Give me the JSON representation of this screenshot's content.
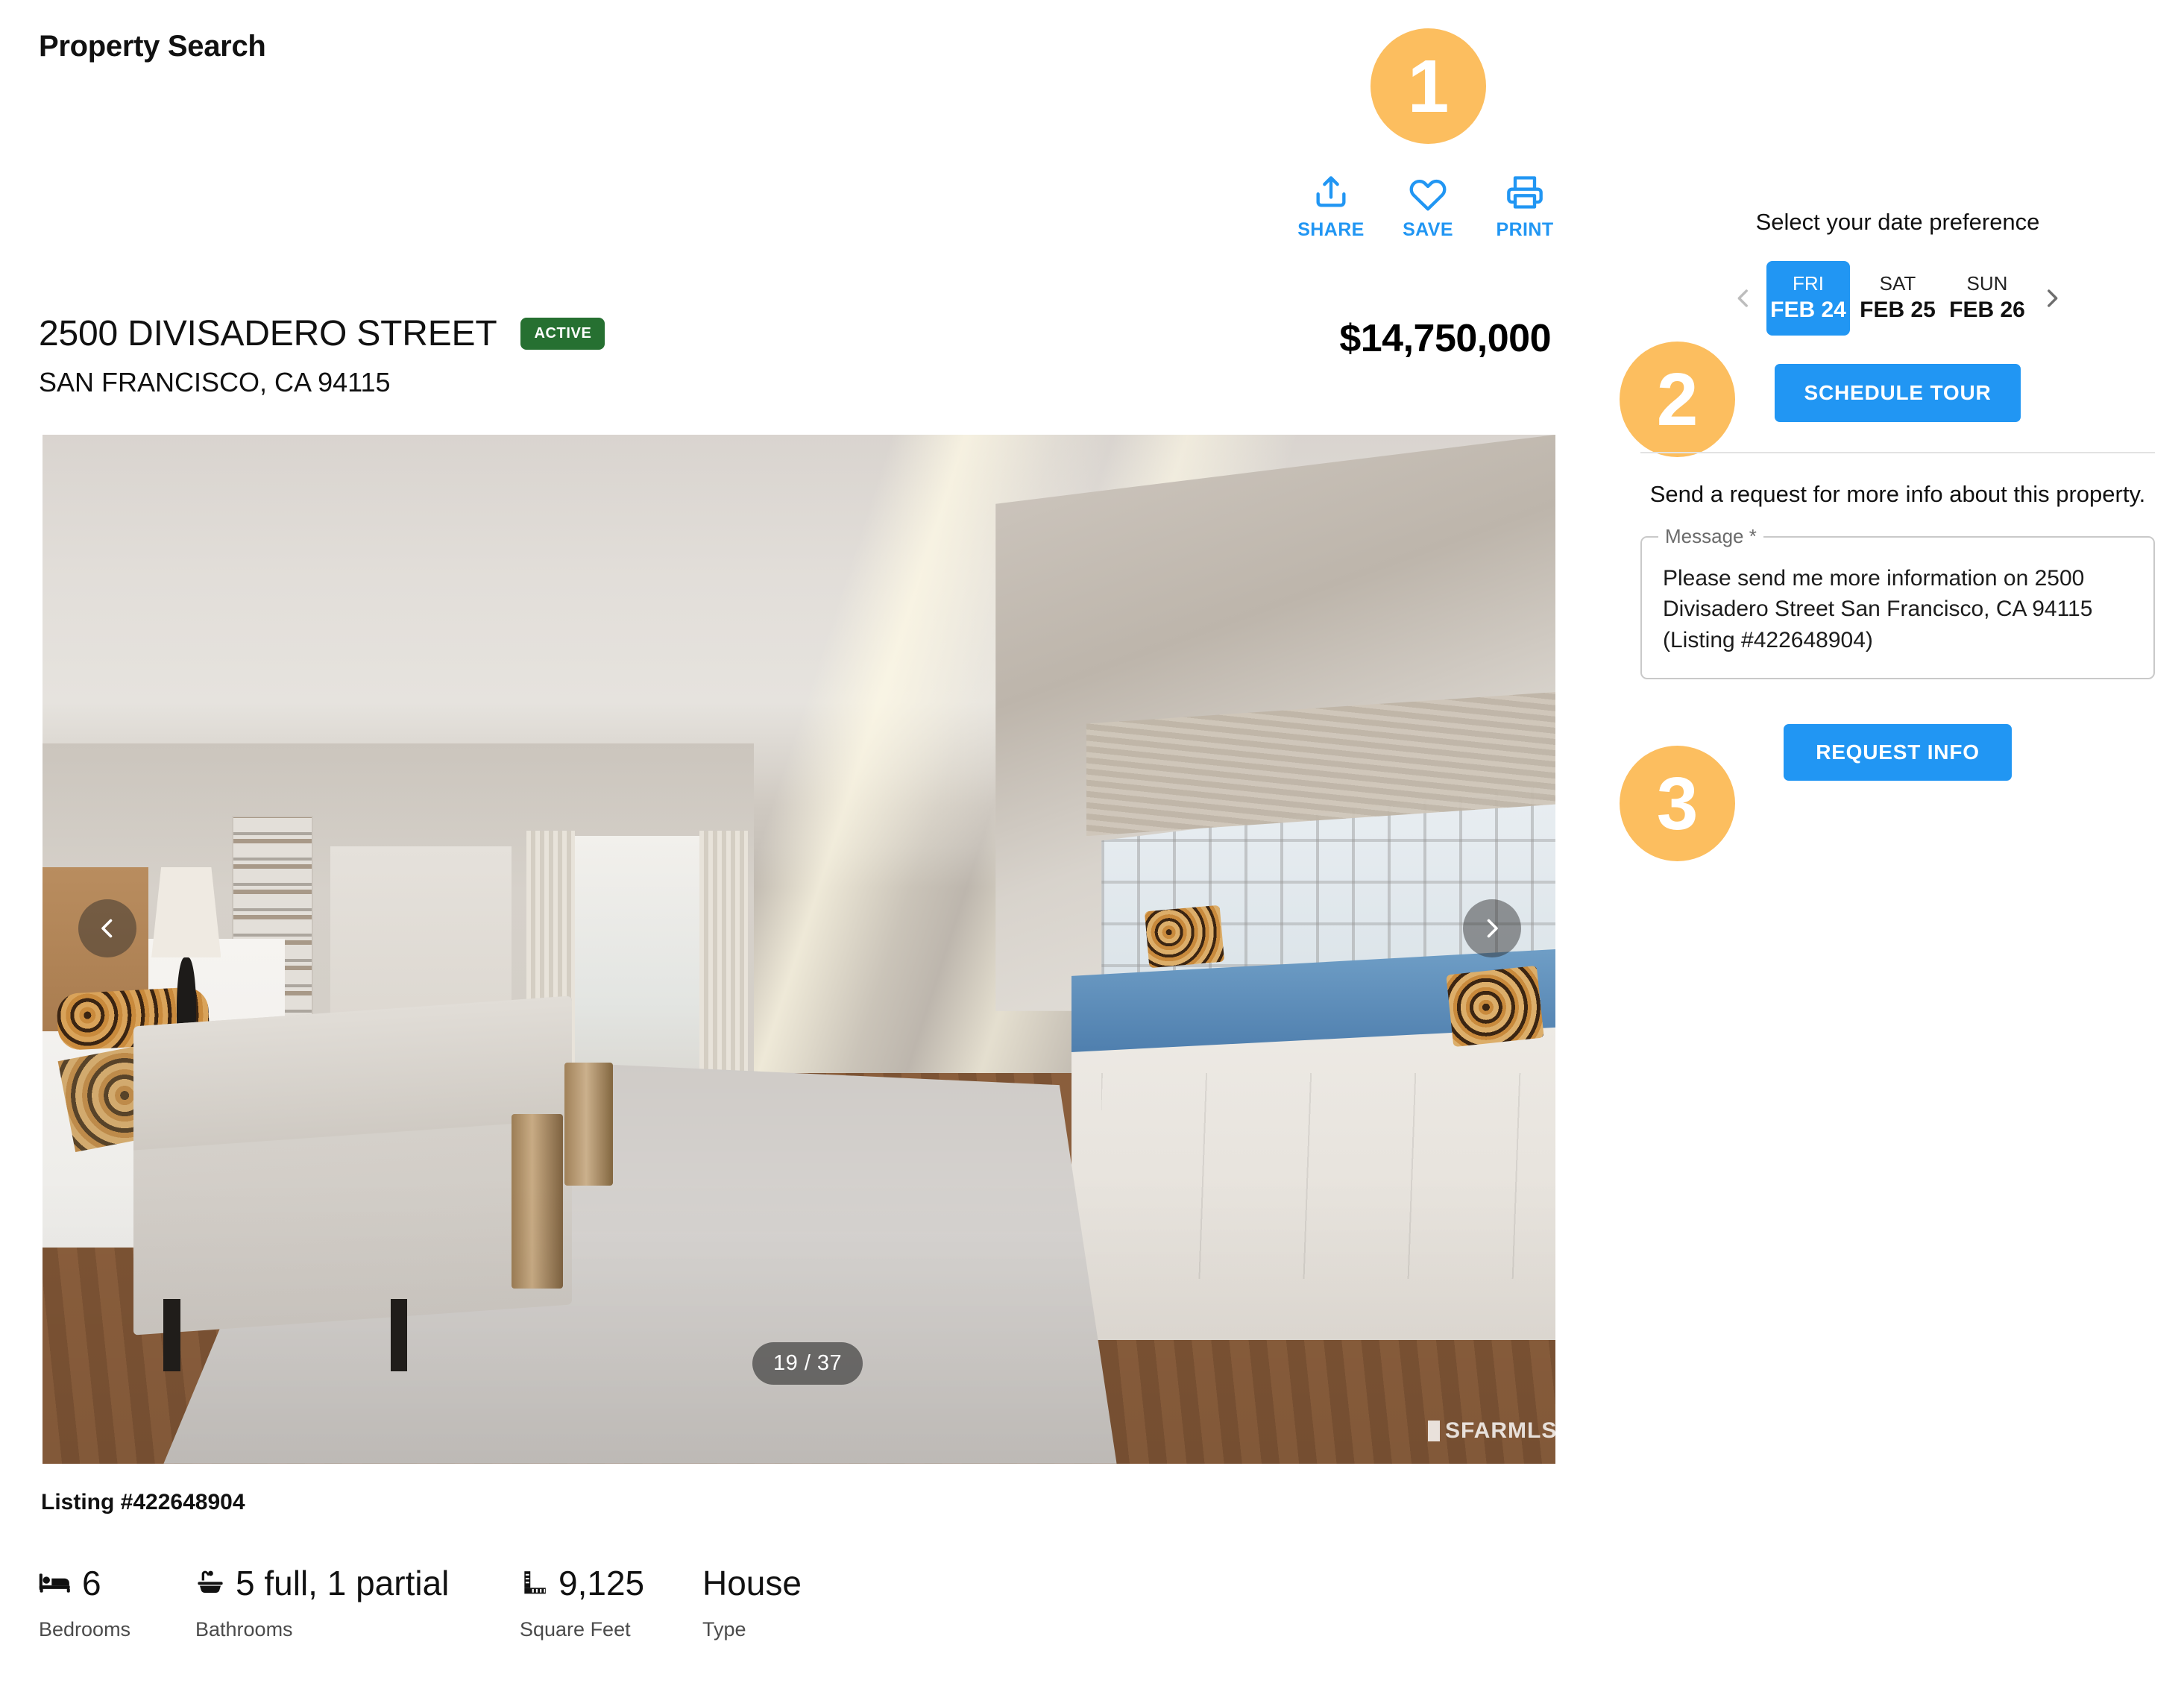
{
  "header": {
    "title": "Property Search"
  },
  "actions": [
    {
      "label": "SHARE",
      "icon": "share-icon"
    },
    {
      "label": "SAVE",
      "icon": "heart-icon"
    },
    {
      "label": "PRINT",
      "icon": "printer-icon"
    }
  ],
  "step_badges": [
    {
      "number": "1"
    },
    {
      "number": "2"
    },
    {
      "number": "3"
    }
  ],
  "listing": {
    "address_line1": "2500 DIVISADERO STREET",
    "address_line2": "SAN FRANCISCO, CA 94115",
    "status": "ACTIVE",
    "price": "$14,750,000",
    "listing_number": "Listing #422648904"
  },
  "carousel": {
    "counter": "19 / 37",
    "current_index": 19,
    "total": 37,
    "watermark": "SFARMLS",
    "prev_label": "chevron-left-icon",
    "next_label": "chevron-right-icon"
  },
  "specs": [
    {
      "icon": "bed-icon",
      "value": "6",
      "label": "Bedrooms"
    },
    {
      "icon": "bath-icon",
      "value": "5 full, 1 partial",
      "label": "Bathrooms"
    },
    {
      "icon": "ruler-icon",
      "value": "9,125",
      "label": "Square Feet"
    },
    {
      "icon": "",
      "value": "House",
      "label": "Type"
    }
  ],
  "sidebar": {
    "date_heading": "Select your date preference",
    "dates": [
      {
        "dow": "FRI",
        "md": "FEB 24",
        "selected": true
      },
      {
        "dow": "SAT",
        "md": "FEB 25",
        "selected": false
      },
      {
        "dow": "SUN",
        "md": "FEB 26",
        "selected": false
      }
    ],
    "schedule_tour_label": "SCHEDULE TOUR",
    "request_heading": "Send a request for more info about this property.",
    "message_legend": "Message *",
    "message_value": "Please send me more information on 2500 Divisadero Street San Francisco, CA 94115 (Listing #422648904)",
    "message_placeholder": "Message",
    "request_info_label": "REQUEST INFO"
  },
  "colors": {
    "accent_blue": "#2196f3",
    "badge_orange": "#fcbe5f",
    "status_green": "#267031",
    "text_dark": "#111111",
    "text_muted": "#4b4b4b"
  }
}
